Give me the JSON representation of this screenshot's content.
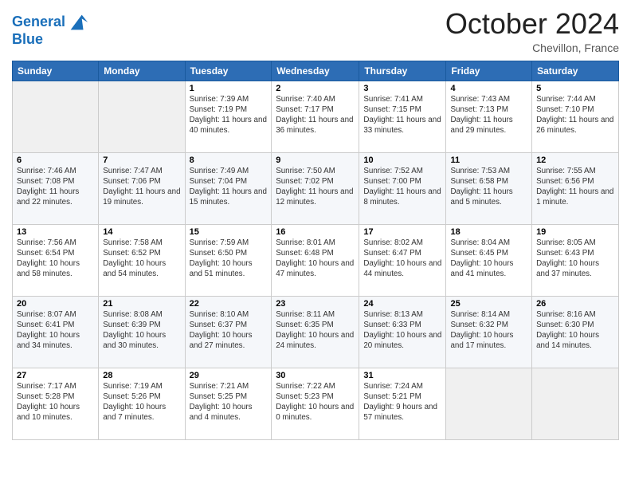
{
  "header": {
    "logo_line1": "General",
    "logo_line2": "Blue",
    "month": "October 2024",
    "location": "Chevillon, France"
  },
  "days_of_week": [
    "Sunday",
    "Monday",
    "Tuesday",
    "Wednesday",
    "Thursday",
    "Friday",
    "Saturday"
  ],
  "weeks": [
    [
      {
        "day": "",
        "sunrise": "",
        "sunset": "",
        "daylight": ""
      },
      {
        "day": "",
        "sunrise": "",
        "sunset": "",
        "daylight": ""
      },
      {
        "day": "1",
        "sunrise": "Sunrise: 7:39 AM",
        "sunset": "Sunset: 7:19 PM",
        "daylight": "Daylight: 11 hours and 40 minutes."
      },
      {
        "day": "2",
        "sunrise": "Sunrise: 7:40 AM",
        "sunset": "Sunset: 7:17 PM",
        "daylight": "Daylight: 11 hours and 36 minutes."
      },
      {
        "day": "3",
        "sunrise": "Sunrise: 7:41 AM",
        "sunset": "Sunset: 7:15 PM",
        "daylight": "Daylight: 11 hours and 33 minutes."
      },
      {
        "day": "4",
        "sunrise": "Sunrise: 7:43 AM",
        "sunset": "Sunset: 7:13 PM",
        "daylight": "Daylight: 11 hours and 29 minutes."
      },
      {
        "day": "5",
        "sunrise": "Sunrise: 7:44 AM",
        "sunset": "Sunset: 7:10 PM",
        "daylight": "Daylight: 11 hours and 26 minutes."
      }
    ],
    [
      {
        "day": "6",
        "sunrise": "Sunrise: 7:46 AM",
        "sunset": "Sunset: 7:08 PM",
        "daylight": "Daylight: 11 hours and 22 minutes."
      },
      {
        "day": "7",
        "sunrise": "Sunrise: 7:47 AM",
        "sunset": "Sunset: 7:06 PM",
        "daylight": "Daylight: 11 hours and 19 minutes."
      },
      {
        "day": "8",
        "sunrise": "Sunrise: 7:49 AM",
        "sunset": "Sunset: 7:04 PM",
        "daylight": "Daylight: 11 hours and 15 minutes."
      },
      {
        "day": "9",
        "sunrise": "Sunrise: 7:50 AM",
        "sunset": "Sunset: 7:02 PM",
        "daylight": "Daylight: 11 hours and 12 minutes."
      },
      {
        "day": "10",
        "sunrise": "Sunrise: 7:52 AM",
        "sunset": "Sunset: 7:00 PM",
        "daylight": "Daylight: 11 hours and 8 minutes."
      },
      {
        "day": "11",
        "sunrise": "Sunrise: 7:53 AM",
        "sunset": "Sunset: 6:58 PM",
        "daylight": "Daylight: 11 hours and 5 minutes."
      },
      {
        "day": "12",
        "sunrise": "Sunrise: 7:55 AM",
        "sunset": "Sunset: 6:56 PM",
        "daylight": "Daylight: 11 hours and 1 minute."
      }
    ],
    [
      {
        "day": "13",
        "sunrise": "Sunrise: 7:56 AM",
        "sunset": "Sunset: 6:54 PM",
        "daylight": "Daylight: 10 hours and 58 minutes."
      },
      {
        "day": "14",
        "sunrise": "Sunrise: 7:58 AM",
        "sunset": "Sunset: 6:52 PM",
        "daylight": "Daylight: 10 hours and 54 minutes."
      },
      {
        "day": "15",
        "sunrise": "Sunrise: 7:59 AM",
        "sunset": "Sunset: 6:50 PM",
        "daylight": "Daylight: 10 hours and 51 minutes."
      },
      {
        "day": "16",
        "sunrise": "Sunrise: 8:01 AM",
        "sunset": "Sunset: 6:48 PM",
        "daylight": "Daylight: 10 hours and 47 minutes."
      },
      {
        "day": "17",
        "sunrise": "Sunrise: 8:02 AM",
        "sunset": "Sunset: 6:47 PM",
        "daylight": "Daylight: 10 hours and 44 minutes."
      },
      {
        "day": "18",
        "sunrise": "Sunrise: 8:04 AM",
        "sunset": "Sunset: 6:45 PM",
        "daylight": "Daylight: 10 hours and 41 minutes."
      },
      {
        "day": "19",
        "sunrise": "Sunrise: 8:05 AM",
        "sunset": "Sunset: 6:43 PM",
        "daylight": "Daylight: 10 hours and 37 minutes."
      }
    ],
    [
      {
        "day": "20",
        "sunrise": "Sunrise: 8:07 AM",
        "sunset": "Sunset: 6:41 PM",
        "daylight": "Daylight: 10 hours and 34 minutes."
      },
      {
        "day": "21",
        "sunrise": "Sunrise: 8:08 AM",
        "sunset": "Sunset: 6:39 PM",
        "daylight": "Daylight: 10 hours and 30 minutes."
      },
      {
        "day": "22",
        "sunrise": "Sunrise: 8:10 AM",
        "sunset": "Sunset: 6:37 PM",
        "daylight": "Daylight: 10 hours and 27 minutes."
      },
      {
        "day": "23",
        "sunrise": "Sunrise: 8:11 AM",
        "sunset": "Sunset: 6:35 PM",
        "daylight": "Daylight: 10 hours and 24 minutes."
      },
      {
        "day": "24",
        "sunrise": "Sunrise: 8:13 AM",
        "sunset": "Sunset: 6:33 PM",
        "daylight": "Daylight: 10 hours and 20 minutes."
      },
      {
        "day": "25",
        "sunrise": "Sunrise: 8:14 AM",
        "sunset": "Sunset: 6:32 PM",
        "daylight": "Daylight: 10 hours and 17 minutes."
      },
      {
        "day": "26",
        "sunrise": "Sunrise: 8:16 AM",
        "sunset": "Sunset: 6:30 PM",
        "daylight": "Daylight: 10 hours and 14 minutes."
      }
    ],
    [
      {
        "day": "27",
        "sunrise": "Sunrise: 7:17 AM",
        "sunset": "Sunset: 5:28 PM",
        "daylight": "Daylight: 10 hours and 10 minutes."
      },
      {
        "day": "28",
        "sunrise": "Sunrise: 7:19 AM",
        "sunset": "Sunset: 5:26 PM",
        "daylight": "Daylight: 10 hours and 7 minutes."
      },
      {
        "day": "29",
        "sunrise": "Sunrise: 7:21 AM",
        "sunset": "Sunset: 5:25 PM",
        "daylight": "Daylight: 10 hours and 4 minutes."
      },
      {
        "day": "30",
        "sunrise": "Sunrise: 7:22 AM",
        "sunset": "Sunset: 5:23 PM",
        "daylight": "Daylight: 10 hours and 0 minutes."
      },
      {
        "day": "31",
        "sunrise": "Sunrise: 7:24 AM",
        "sunset": "Sunset: 5:21 PM",
        "daylight": "Daylight: 9 hours and 57 minutes."
      },
      {
        "day": "",
        "sunrise": "",
        "sunset": "",
        "daylight": ""
      },
      {
        "day": "",
        "sunrise": "",
        "sunset": "",
        "daylight": ""
      }
    ]
  ]
}
